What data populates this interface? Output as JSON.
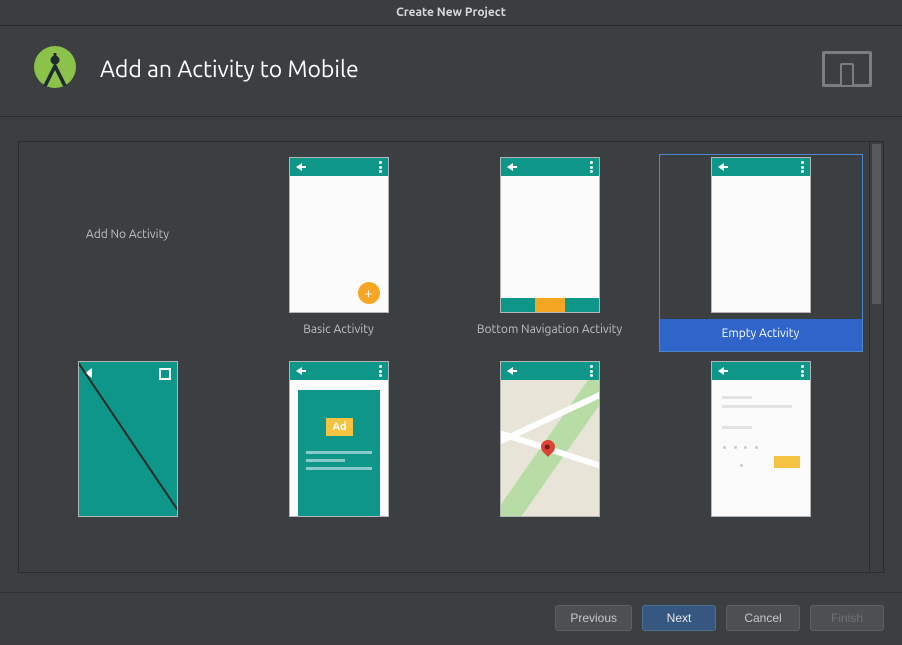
{
  "window": {
    "title": "Create New Project"
  },
  "header": {
    "title": "Add an Activity to Mobile"
  },
  "templates": [
    {
      "key": "none",
      "label": "Add No Activity",
      "selected": false
    },
    {
      "key": "basic",
      "label": "Basic Activity",
      "selected": false
    },
    {
      "key": "bottomnav",
      "label": "Bottom Navigation Activity",
      "selected": false
    },
    {
      "key": "empty",
      "label": "Empty Activity",
      "selected": true
    },
    {
      "key": "fullscreen",
      "label": "",
      "selected": false
    },
    {
      "key": "admob",
      "label": "",
      "selected": false
    },
    {
      "key": "maps",
      "label": "",
      "selected": false
    },
    {
      "key": "login",
      "label": "",
      "selected": false
    }
  ],
  "ad_badge": "Ad",
  "buttons": {
    "previous": "Previous",
    "next": "Next",
    "cancel": "Cancel",
    "finish": "Finish"
  }
}
